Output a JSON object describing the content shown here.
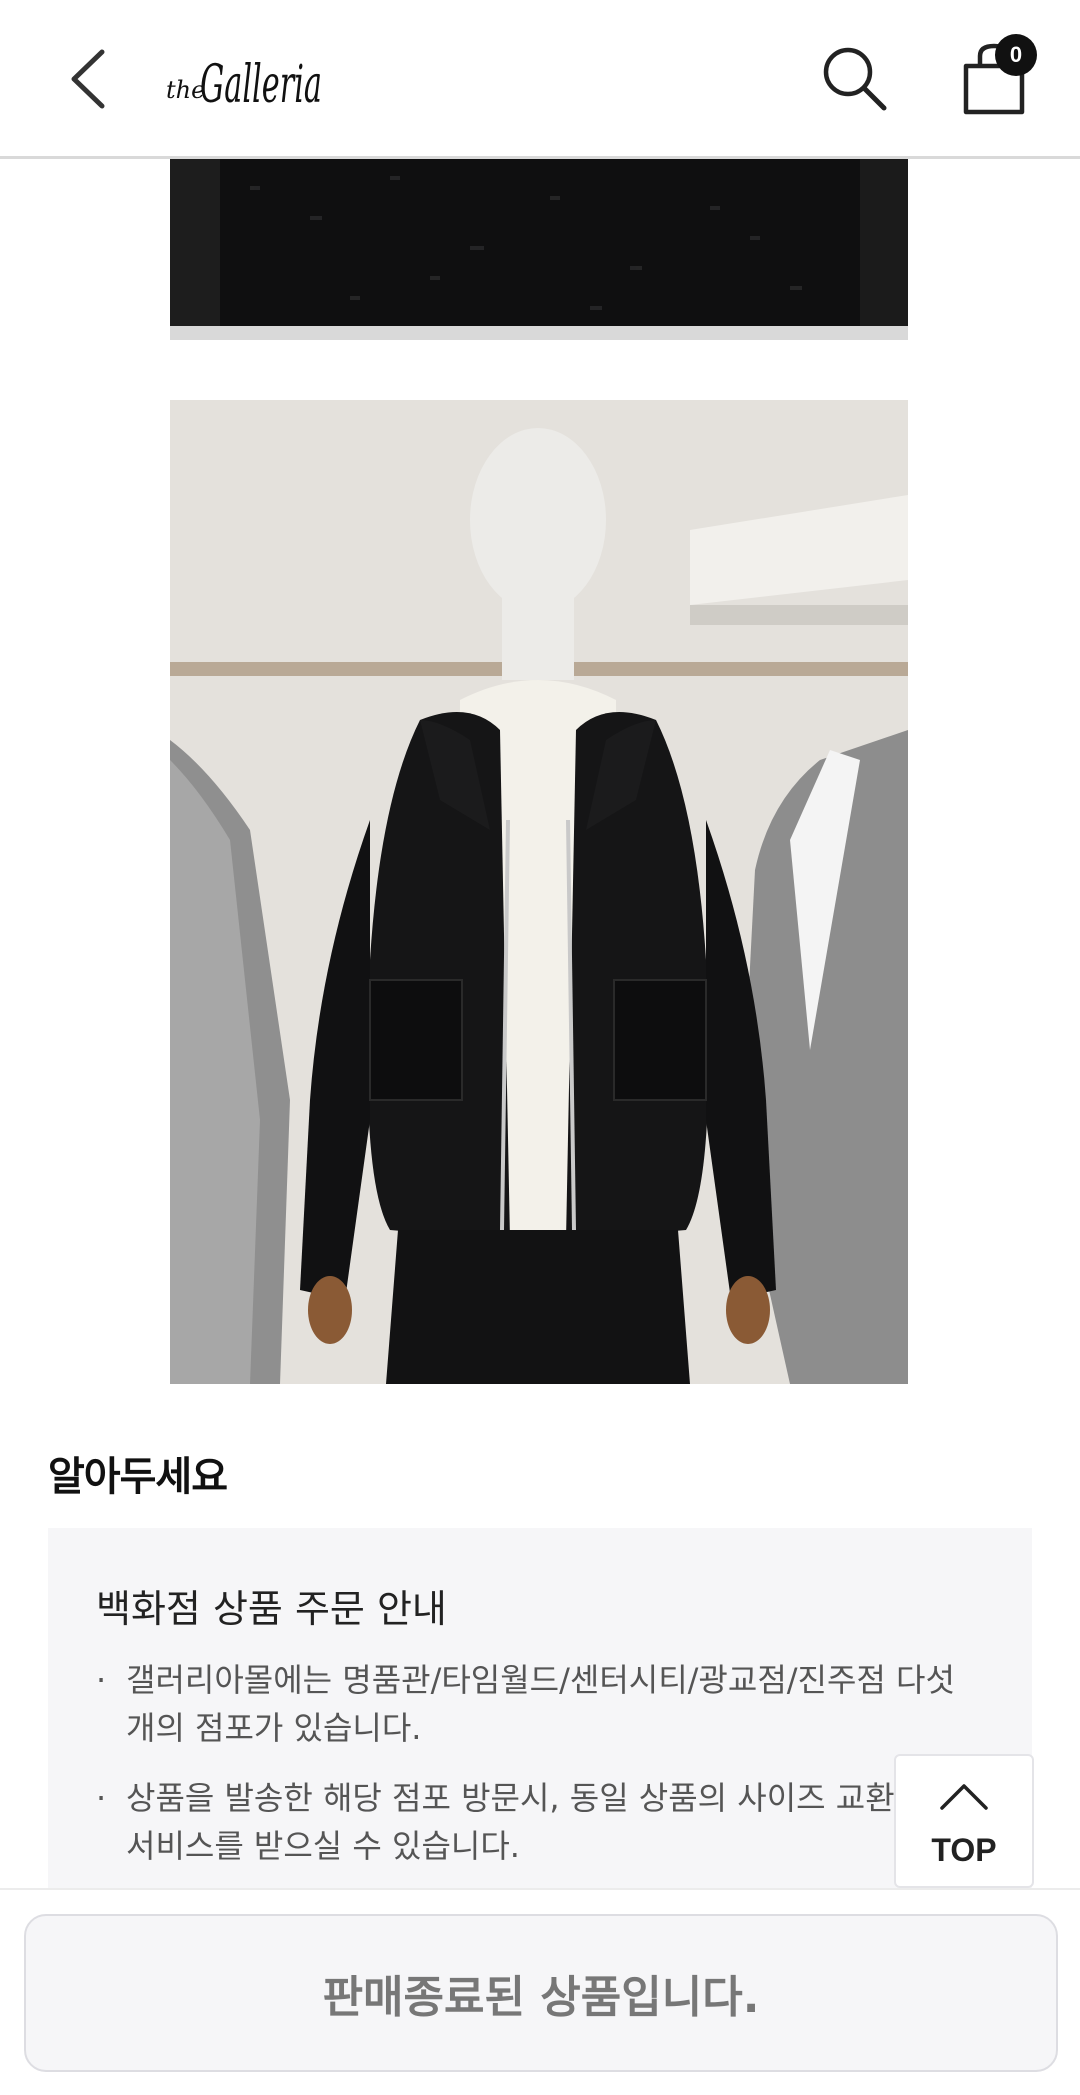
{
  "header": {
    "logo_text": "theGalleria",
    "cart_count": "0",
    "icons": [
      "chevron-left-icon",
      "search-icon",
      "shopping-bag-icon"
    ]
  },
  "notice": {
    "title": "알아두세요",
    "subtitle": "백화점 상품 주문 안내",
    "bullets": [
      "갤러리아몰에는 명품관/타임월드/센터시티/광교점/진주점 다섯 개의 점포가 있습니다.",
      "상품을 발송한 해당 점포 방문시, 동일 상품의 사이즈 교환 등 선서비스를 받으실 수 있습니다."
    ]
  },
  "top_button": {
    "label": "TOP"
  },
  "footer": {
    "status_label": "판매종료된 상품입니다."
  }
}
